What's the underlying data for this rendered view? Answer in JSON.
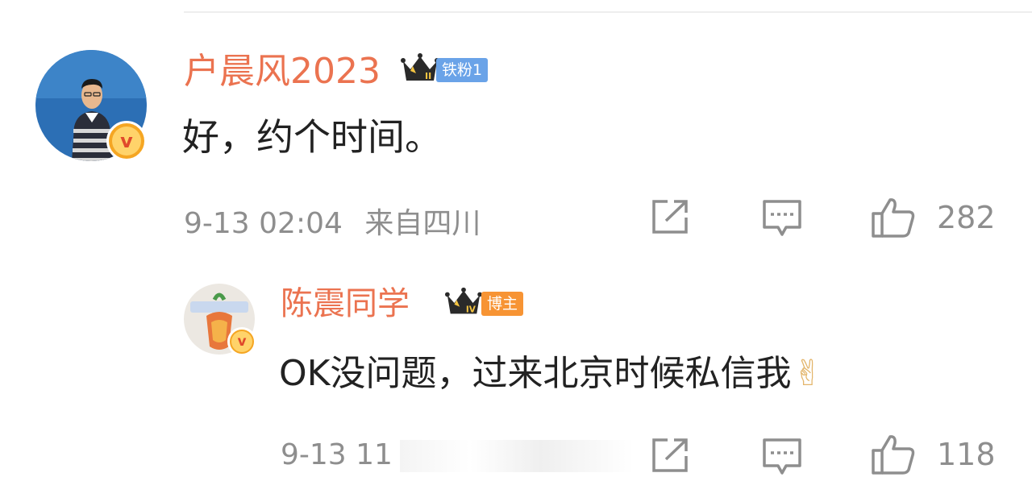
{
  "comments": [
    {
      "username": "户晨风2023",
      "crown_level": "II",
      "tag": "铁粉1",
      "tag_color": "#6aa3e8",
      "content": "好，约个时间。",
      "timestamp": "9-13 02:04",
      "location": "来自四川",
      "like_count": "282"
    },
    {
      "username": "陈震同学",
      "crown_level": "IV",
      "tag": "博主",
      "tag_color": "#f79434",
      "content": "OK没问题，过来北京时候私信我",
      "content_emoji": "✌",
      "timestamp": "9-13 11",
      "like_count": "118"
    }
  ],
  "colors": {
    "username": "#eb7350",
    "content": "#222222",
    "meta": "#8e8e8e",
    "verified_badge": "#f5a623"
  },
  "icons": [
    "share-icon",
    "comment-icon",
    "like-icon",
    "crown-icon",
    "verified-icon",
    "victory-hand-icon"
  ]
}
